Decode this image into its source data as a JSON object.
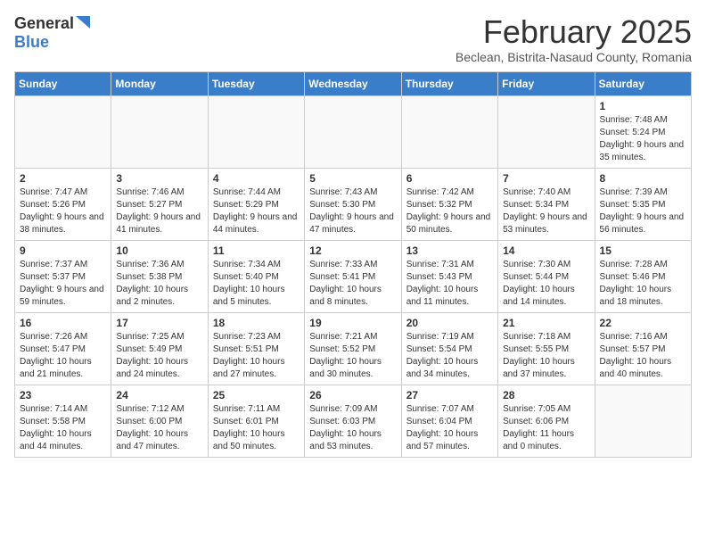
{
  "logo": {
    "general": "General",
    "blue": "Blue"
  },
  "title": "February 2025",
  "subtitle": "Beclean, Bistrita-Nasaud County, Romania",
  "days": [
    "Sunday",
    "Monday",
    "Tuesday",
    "Wednesday",
    "Thursday",
    "Friday",
    "Saturday"
  ],
  "weeks": [
    [
      {
        "num": "",
        "info": ""
      },
      {
        "num": "",
        "info": ""
      },
      {
        "num": "",
        "info": ""
      },
      {
        "num": "",
        "info": ""
      },
      {
        "num": "",
        "info": ""
      },
      {
        "num": "",
        "info": ""
      },
      {
        "num": "1",
        "info": "Sunrise: 7:48 AM\nSunset: 5:24 PM\nDaylight: 9 hours and 35 minutes."
      }
    ],
    [
      {
        "num": "2",
        "info": "Sunrise: 7:47 AM\nSunset: 5:26 PM\nDaylight: 9 hours and 38 minutes."
      },
      {
        "num": "3",
        "info": "Sunrise: 7:46 AM\nSunset: 5:27 PM\nDaylight: 9 hours and 41 minutes."
      },
      {
        "num": "4",
        "info": "Sunrise: 7:44 AM\nSunset: 5:29 PM\nDaylight: 9 hours and 44 minutes."
      },
      {
        "num": "5",
        "info": "Sunrise: 7:43 AM\nSunset: 5:30 PM\nDaylight: 9 hours and 47 minutes."
      },
      {
        "num": "6",
        "info": "Sunrise: 7:42 AM\nSunset: 5:32 PM\nDaylight: 9 hours and 50 minutes."
      },
      {
        "num": "7",
        "info": "Sunrise: 7:40 AM\nSunset: 5:34 PM\nDaylight: 9 hours and 53 minutes."
      },
      {
        "num": "8",
        "info": "Sunrise: 7:39 AM\nSunset: 5:35 PM\nDaylight: 9 hours and 56 minutes."
      }
    ],
    [
      {
        "num": "9",
        "info": "Sunrise: 7:37 AM\nSunset: 5:37 PM\nDaylight: 9 hours and 59 minutes."
      },
      {
        "num": "10",
        "info": "Sunrise: 7:36 AM\nSunset: 5:38 PM\nDaylight: 10 hours and 2 minutes."
      },
      {
        "num": "11",
        "info": "Sunrise: 7:34 AM\nSunset: 5:40 PM\nDaylight: 10 hours and 5 minutes."
      },
      {
        "num": "12",
        "info": "Sunrise: 7:33 AM\nSunset: 5:41 PM\nDaylight: 10 hours and 8 minutes."
      },
      {
        "num": "13",
        "info": "Sunrise: 7:31 AM\nSunset: 5:43 PM\nDaylight: 10 hours and 11 minutes."
      },
      {
        "num": "14",
        "info": "Sunrise: 7:30 AM\nSunset: 5:44 PM\nDaylight: 10 hours and 14 minutes."
      },
      {
        "num": "15",
        "info": "Sunrise: 7:28 AM\nSunset: 5:46 PM\nDaylight: 10 hours and 18 minutes."
      }
    ],
    [
      {
        "num": "16",
        "info": "Sunrise: 7:26 AM\nSunset: 5:47 PM\nDaylight: 10 hours and 21 minutes."
      },
      {
        "num": "17",
        "info": "Sunrise: 7:25 AM\nSunset: 5:49 PM\nDaylight: 10 hours and 24 minutes."
      },
      {
        "num": "18",
        "info": "Sunrise: 7:23 AM\nSunset: 5:51 PM\nDaylight: 10 hours and 27 minutes."
      },
      {
        "num": "19",
        "info": "Sunrise: 7:21 AM\nSunset: 5:52 PM\nDaylight: 10 hours and 30 minutes."
      },
      {
        "num": "20",
        "info": "Sunrise: 7:19 AM\nSunset: 5:54 PM\nDaylight: 10 hours and 34 minutes."
      },
      {
        "num": "21",
        "info": "Sunrise: 7:18 AM\nSunset: 5:55 PM\nDaylight: 10 hours and 37 minutes."
      },
      {
        "num": "22",
        "info": "Sunrise: 7:16 AM\nSunset: 5:57 PM\nDaylight: 10 hours and 40 minutes."
      }
    ],
    [
      {
        "num": "23",
        "info": "Sunrise: 7:14 AM\nSunset: 5:58 PM\nDaylight: 10 hours and 44 minutes."
      },
      {
        "num": "24",
        "info": "Sunrise: 7:12 AM\nSunset: 6:00 PM\nDaylight: 10 hours and 47 minutes."
      },
      {
        "num": "25",
        "info": "Sunrise: 7:11 AM\nSunset: 6:01 PM\nDaylight: 10 hours and 50 minutes."
      },
      {
        "num": "26",
        "info": "Sunrise: 7:09 AM\nSunset: 6:03 PM\nDaylight: 10 hours and 53 minutes."
      },
      {
        "num": "27",
        "info": "Sunrise: 7:07 AM\nSunset: 6:04 PM\nDaylight: 10 hours and 57 minutes."
      },
      {
        "num": "28",
        "info": "Sunrise: 7:05 AM\nSunset: 6:06 PM\nDaylight: 11 hours and 0 minutes."
      },
      {
        "num": "",
        "info": ""
      }
    ]
  ]
}
